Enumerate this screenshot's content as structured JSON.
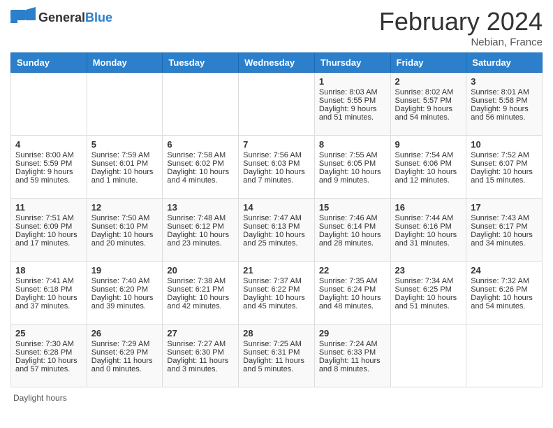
{
  "header": {
    "logo_general": "General",
    "logo_blue": "Blue",
    "title": "February 2024",
    "location": "Nebian, France"
  },
  "days_of_week": [
    "Sunday",
    "Monday",
    "Tuesday",
    "Wednesday",
    "Thursday",
    "Friday",
    "Saturday"
  ],
  "weeks": [
    [
      {
        "day": "",
        "sunrise": "",
        "sunset": "",
        "daylight": ""
      },
      {
        "day": "",
        "sunrise": "",
        "sunset": "",
        "daylight": ""
      },
      {
        "day": "",
        "sunrise": "",
        "sunset": "",
        "daylight": ""
      },
      {
        "day": "",
        "sunrise": "",
        "sunset": "",
        "daylight": ""
      },
      {
        "day": "1",
        "sunrise": "Sunrise: 8:03 AM",
        "sunset": "Sunset: 5:55 PM",
        "daylight": "Daylight: 9 hours and 51 minutes."
      },
      {
        "day": "2",
        "sunrise": "Sunrise: 8:02 AM",
        "sunset": "Sunset: 5:57 PM",
        "daylight": "Daylight: 9 hours and 54 minutes."
      },
      {
        "day": "3",
        "sunrise": "Sunrise: 8:01 AM",
        "sunset": "Sunset: 5:58 PM",
        "daylight": "Daylight: 9 hours and 56 minutes."
      }
    ],
    [
      {
        "day": "4",
        "sunrise": "Sunrise: 8:00 AM",
        "sunset": "Sunset: 5:59 PM",
        "daylight": "Daylight: 9 hours and 59 minutes."
      },
      {
        "day": "5",
        "sunrise": "Sunrise: 7:59 AM",
        "sunset": "Sunset: 6:01 PM",
        "daylight": "Daylight: 10 hours and 1 minute."
      },
      {
        "day": "6",
        "sunrise": "Sunrise: 7:58 AM",
        "sunset": "Sunset: 6:02 PM",
        "daylight": "Daylight: 10 hours and 4 minutes."
      },
      {
        "day": "7",
        "sunrise": "Sunrise: 7:56 AM",
        "sunset": "Sunset: 6:03 PM",
        "daylight": "Daylight: 10 hours and 7 minutes."
      },
      {
        "day": "8",
        "sunrise": "Sunrise: 7:55 AM",
        "sunset": "Sunset: 6:05 PM",
        "daylight": "Daylight: 10 hours and 9 minutes."
      },
      {
        "day": "9",
        "sunrise": "Sunrise: 7:54 AM",
        "sunset": "Sunset: 6:06 PM",
        "daylight": "Daylight: 10 hours and 12 minutes."
      },
      {
        "day": "10",
        "sunrise": "Sunrise: 7:52 AM",
        "sunset": "Sunset: 6:07 PM",
        "daylight": "Daylight: 10 hours and 15 minutes."
      }
    ],
    [
      {
        "day": "11",
        "sunrise": "Sunrise: 7:51 AM",
        "sunset": "Sunset: 6:09 PM",
        "daylight": "Daylight: 10 hours and 17 minutes."
      },
      {
        "day": "12",
        "sunrise": "Sunrise: 7:50 AM",
        "sunset": "Sunset: 6:10 PM",
        "daylight": "Daylight: 10 hours and 20 minutes."
      },
      {
        "day": "13",
        "sunrise": "Sunrise: 7:48 AM",
        "sunset": "Sunset: 6:12 PM",
        "daylight": "Daylight: 10 hours and 23 minutes."
      },
      {
        "day": "14",
        "sunrise": "Sunrise: 7:47 AM",
        "sunset": "Sunset: 6:13 PM",
        "daylight": "Daylight: 10 hours and 25 minutes."
      },
      {
        "day": "15",
        "sunrise": "Sunrise: 7:46 AM",
        "sunset": "Sunset: 6:14 PM",
        "daylight": "Daylight: 10 hours and 28 minutes."
      },
      {
        "day": "16",
        "sunrise": "Sunrise: 7:44 AM",
        "sunset": "Sunset: 6:16 PM",
        "daylight": "Daylight: 10 hours and 31 minutes."
      },
      {
        "day": "17",
        "sunrise": "Sunrise: 7:43 AM",
        "sunset": "Sunset: 6:17 PM",
        "daylight": "Daylight: 10 hours and 34 minutes."
      }
    ],
    [
      {
        "day": "18",
        "sunrise": "Sunrise: 7:41 AM",
        "sunset": "Sunset: 6:18 PM",
        "daylight": "Daylight: 10 hours and 37 minutes."
      },
      {
        "day": "19",
        "sunrise": "Sunrise: 7:40 AM",
        "sunset": "Sunset: 6:20 PM",
        "daylight": "Daylight: 10 hours and 39 minutes."
      },
      {
        "day": "20",
        "sunrise": "Sunrise: 7:38 AM",
        "sunset": "Sunset: 6:21 PM",
        "daylight": "Daylight: 10 hours and 42 minutes."
      },
      {
        "day": "21",
        "sunrise": "Sunrise: 7:37 AM",
        "sunset": "Sunset: 6:22 PM",
        "daylight": "Daylight: 10 hours and 45 minutes."
      },
      {
        "day": "22",
        "sunrise": "Sunrise: 7:35 AM",
        "sunset": "Sunset: 6:24 PM",
        "daylight": "Daylight: 10 hours and 48 minutes."
      },
      {
        "day": "23",
        "sunrise": "Sunrise: 7:34 AM",
        "sunset": "Sunset: 6:25 PM",
        "daylight": "Daylight: 10 hours and 51 minutes."
      },
      {
        "day": "24",
        "sunrise": "Sunrise: 7:32 AM",
        "sunset": "Sunset: 6:26 PM",
        "daylight": "Daylight: 10 hours and 54 minutes."
      }
    ],
    [
      {
        "day": "25",
        "sunrise": "Sunrise: 7:30 AM",
        "sunset": "Sunset: 6:28 PM",
        "daylight": "Daylight: 10 hours and 57 minutes."
      },
      {
        "day": "26",
        "sunrise": "Sunrise: 7:29 AM",
        "sunset": "Sunset: 6:29 PM",
        "daylight": "Daylight: 11 hours and 0 minutes."
      },
      {
        "day": "27",
        "sunrise": "Sunrise: 7:27 AM",
        "sunset": "Sunset: 6:30 PM",
        "daylight": "Daylight: 11 hours and 3 minutes."
      },
      {
        "day": "28",
        "sunrise": "Sunrise: 7:25 AM",
        "sunset": "Sunset: 6:31 PM",
        "daylight": "Daylight: 11 hours and 5 minutes."
      },
      {
        "day": "29",
        "sunrise": "Sunrise: 7:24 AM",
        "sunset": "Sunset: 6:33 PM",
        "daylight": "Daylight: 11 hours and 8 minutes."
      },
      {
        "day": "",
        "sunrise": "",
        "sunset": "",
        "daylight": ""
      },
      {
        "day": "",
        "sunrise": "",
        "sunset": "",
        "daylight": ""
      }
    ]
  ],
  "footer": "Daylight hours"
}
